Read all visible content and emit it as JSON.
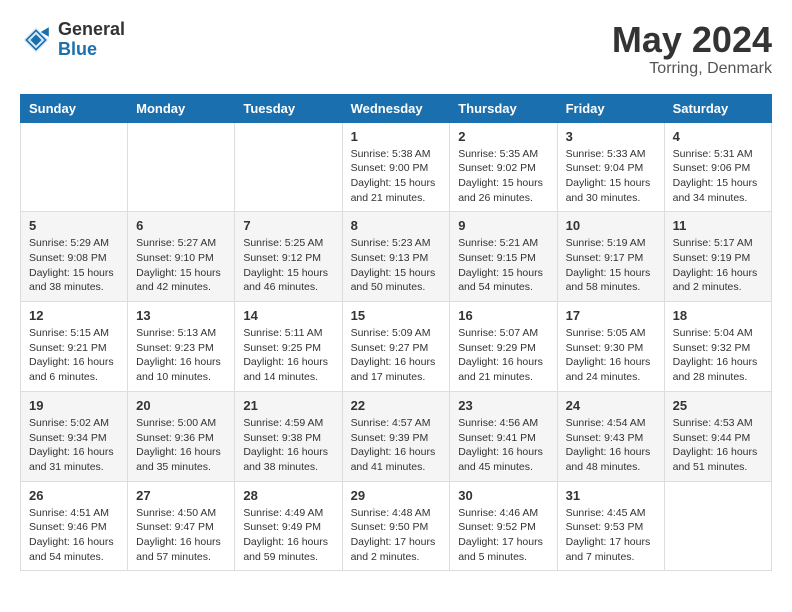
{
  "header": {
    "logo_general": "General",
    "logo_blue": "Blue",
    "month_year": "May 2024",
    "location": "Torring, Denmark"
  },
  "days_of_week": [
    "Sunday",
    "Monday",
    "Tuesday",
    "Wednesday",
    "Thursday",
    "Friday",
    "Saturday"
  ],
  "weeks": [
    [
      {
        "day": "",
        "info": ""
      },
      {
        "day": "",
        "info": ""
      },
      {
        "day": "",
        "info": ""
      },
      {
        "day": "1",
        "info": "Sunrise: 5:38 AM\nSunset: 9:00 PM\nDaylight: 15 hours\nand 21 minutes."
      },
      {
        "day": "2",
        "info": "Sunrise: 5:35 AM\nSunset: 9:02 PM\nDaylight: 15 hours\nand 26 minutes."
      },
      {
        "day": "3",
        "info": "Sunrise: 5:33 AM\nSunset: 9:04 PM\nDaylight: 15 hours\nand 30 minutes."
      },
      {
        "day": "4",
        "info": "Sunrise: 5:31 AM\nSunset: 9:06 PM\nDaylight: 15 hours\nand 34 minutes."
      }
    ],
    [
      {
        "day": "5",
        "info": "Sunrise: 5:29 AM\nSunset: 9:08 PM\nDaylight: 15 hours\nand 38 minutes."
      },
      {
        "day": "6",
        "info": "Sunrise: 5:27 AM\nSunset: 9:10 PM\nDaylight: 15 hours\nand 42 minutes."
      },
      {
        "day": "7",
        "info": "Sunrise: 5:25 AM\nSunset: 9:12 PM\nDaylight: 15 hours\nand 46 minutes."
      },
      {
        "day": "8",
        "info": "Sunrise: 5:23 AM\nSunset: 9:13 PM\nDaylight: 15 hours\nand 50 minutes."
      },
      {
        "day": "9",
        "info": "Sunrise: 5:21 AM\nSunset: 9:15 PM\nDaylight: 15 hours\nand 54 minutes."
      },
      {
        "day": "10",
        "info": "Sunrise: 5:19 AM\nSunset: 9:17 PM\nDaylight: 15 hours\nand 58 minutes."
      },
      {
        "day": "11",
        "info": "Sunrise: 5:17 AM\nSunset: 9:19 PM\nDaylight: 16 hours\nand 2 minutes."
      }
    ],
    [
      {
        "day": "12",
        "info": "Sunrise: 5:15 AM\nSunset: 9:21 PM\nDaylight: 16 hours\nand 6 minutes."
      },
      {
        "day": "13",
        "info": "Sunrise: 5:13 AM\nSunset: 9:23 PM\nDaylight: 16 hours\nand 10 minutes."
      },
      {
        "day": "14",
        "info": "Sunrise: 5:11 AM\nSunset: 9:25 PM\nDaylight: 16 hours\nand 14 minutes."
      },
      {
        "day": "15",
        "info": "Sunrise: 5:09 AM\nSunset: 9:27 PM\nDaylight: 16 hours\nand 17 minutes."
      },
      {
        "day": "16",
        "info": "Sunrise: 5:07 AM\nSunset: 9:29 PM\nDaylight: 16 hours\nand 21 minutes."
      },
      {
        "day": "17",
        "info": "Sunrise: 5:05 AM\nSunset: 9:30 PM\nDaylight: 16 hours\nand 24 minutes."
      },
      {
        "day": "18",
        "info": "Sunrise: 5:04 AM\nSunset: 9:32 PM\nDaylight: 16 hours\nand 28 minutes."
      }
    ],
    [
      {
        "day": "19",
        "info": "Sunrise: 5:02 AM\nSunset: 9:34 PM\nDaylight: 16 hours\nand 31 minutes."
      },
      {
        "day": "20",
        "info": "Sunrise: 5:00 AM\nSunset: 9:36 PM\nDaylight: 16 hours\nand 35 minutes."
      },
      {
        "day": "21",
        "info": "Sunrise: 4:59 AM\nSunset: 9:38 PM\nDaylight: 16 hours\nand 38 minutes."
      },
      {
        "day": "22",
        "info": "Sunrise: 4:57 AM\nSunset: 9:39 PM\nDaylight: 16 hours\nand 41 minutes."
      },
      {
        "day": "23",
        "info": "Sunrise: 4:56 AM\nSunset: 9:41 PM\nDaylight: 16 hours\nand 45 minutes."
      },
      {
        "day": "24",
        "info": "Sunrise: 4:54 AM\nSunset: 9:43 PM\nDaylight: 16 hours\nand 48 minutes."
      },
      {
        "day": "25",
        "info": "Sunrise: 4:53 AM\nSunset: 9:44 PM\nDaylight: 16 hours\nand 51 minutes."
      }
    ],
    [
      {
        "day": "26",
        "info": "Sunrise: 4:51 AM\nSunset: 9:46 PM\nDaylight: 16 hours\nand 54 minutes."
      },
      {
        "day": "27",
        "info": "Sunrise: 4:50 AM\nSunset: 9:47 PM\nDaylight: 16 hours\nand 57 minutes."
      },
      {
        "day": "28",
        "info": "Sunrise: 4:49 AM\nSunset: 9:49 PM\nDaylight: 16 hours\nand 59 minutes."
      },
      {
        "day": "29",
        "info": "Sunrise: 4:48 AM\nSunset: 9:50 PM\nDaylight: 17 hours\nand 2 minutes."
      },
      {
        "day": "30",
        "info": "Sunrise: 4:46 AM\nSunset: 9:52 PM\nDaylight: 17 hours\nand 5 minutes."
      },
      {
        "day": "31",
        "info": "Sunrise: 4:45 AM\nSunset: 9:53 PM\nDaylight: 17 hours\nand 7 minutes."
      },
      {
        "day": "",
        "info": ""
      }
    ]
  ]
}
